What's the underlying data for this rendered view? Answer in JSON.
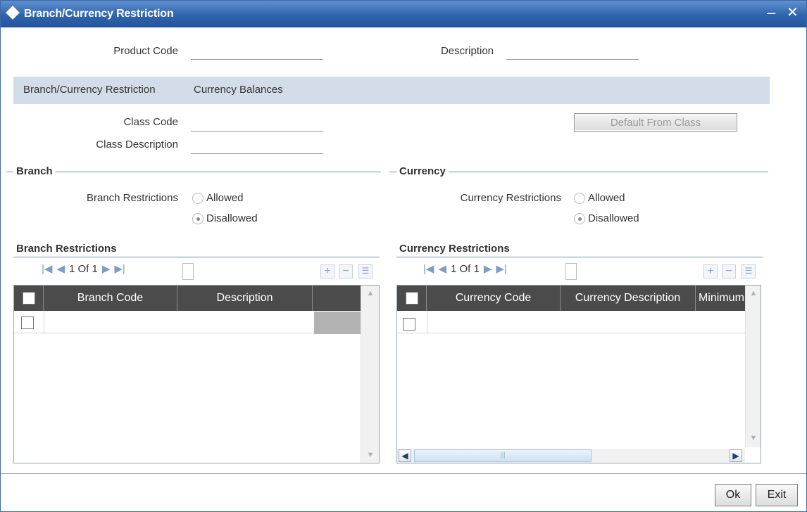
{
  "window": {
    "title": "Branch/Currency Restriction",
    "minimize": "–",
    "close": "✕"
  },
  "header": {
    "product_code_label": "Product Code",
    "product_code_value": "",
    "description_label": "Description",
    "description_value": ""
  },
  "tabs": [
    "Branch/Currency Restriction",
    "Currency Balances"
  ],
  "class": {
    "class_code_label": "Class Code",
    "class_code_value": "",
    "class_description_label": "Class Description",
    "class_description_value": "",
    "default_button": "Default From Class"
  },
  "branch": {
    "section_title": "Branch",
    "restrictions_label": "Branch Restrictions",
    "options": [
      "Allowed",
      "Disallowed"
    ],
    "selected": "Disallowed",
    "grid_title": "Branch Restrictions",
    "pager": "1 Of 1",
    "columns": [
      "Branch Code",
      "Description"
    ]
  },
  "currency": {
    "section_title": "Currency",
    "restrictions_label": "Currency Restrictions",
    "options": [
      "Allowed",
      "Disallowed"
    ],
    "selected": "Disallowed",
    "grid_title": "Currency Restrictions",
    "pager": "1 Of 1",
    "columns": [
      "Currency Code",
      "Currency Description",
      "Minimum"
    ]
  },
  "footer": {
    "ok": "Ok",
    "exit": "Exit"
  },
  "colors": {
    "titlebar": "#2f64ad",
    "tab_strip": "#d3dde9",
    "grid_header": "#4b4b4b",
    "section_line": "#6f8fb8"
  }
}
